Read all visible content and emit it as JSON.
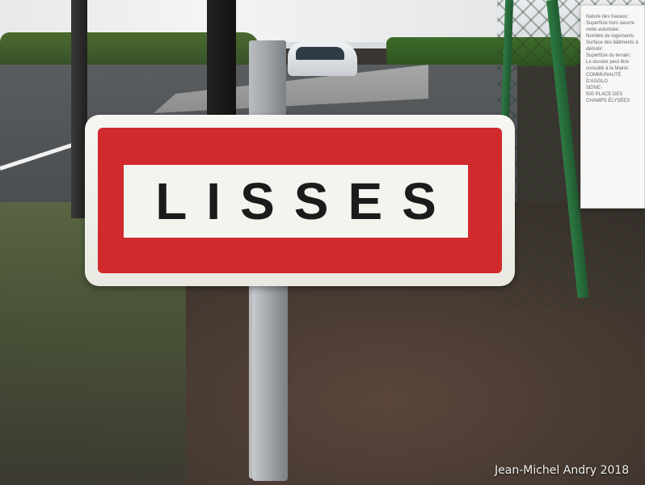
{
  "sign": {
    "town_name": "LISSES",
    "colors": {
      "border": "#d12a2c",
      "background": "#f4f4ef",
      "text": "#1b1b1b"
    }
  },
  "watermark": {
    "text": "Jean-Michel Andry 2018"
  },
  "notice_board": {
    "lines": [
      "Nature des travaux:",
      "Superficie hors oeuvre nette autorisée:",
      "Nombre de logements:",
      "Surface des bâtiments à démolir:",
      "Superficie du terrain:",
      "Le dossier peut être consulté à la Mairie:",
      "COMMUNAUTÉ D'AGGLO",
      "SEINE-",
      "500 PLACE DES CHAMPS ÉLYSÉES"
    ]
  }
}
